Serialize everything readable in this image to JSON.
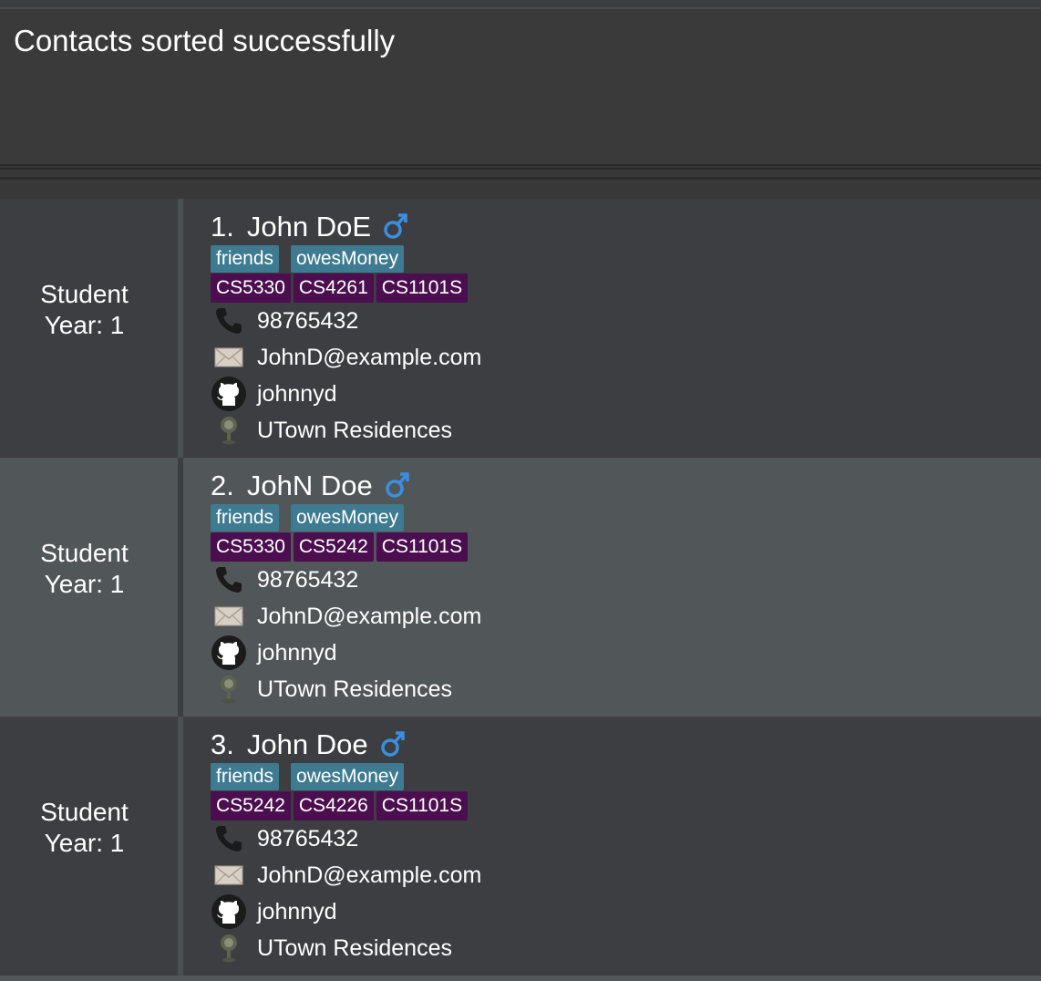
{
  "result": {
    "message": "Contacts sorted successfully"
  },
  "contacts": [
    {
      "index": "1.",
      "name": "John DoE",
      "role": "Student",
      "year": "Year: 1",
      "tags": [
        "friends",
        "owesMoney"
      ],
      "modules": [
        "CS5330",
        "CS4261",
        "CS1101S"
      ],
      "phone": "98765432",
      "email": "JohnD@example.com",
      "github": "johnnyd",
      "address": "UTown Residences"
    },
    {
      "index": "2.",
      "name": "JohN Doe",
      "role": "Student",
      "year": "Year: 1",
      "tags": [
        "friends",
        "owesMoney"
      ],
      "modules": [
        "CS5330",
        "CS5242",
        "CS1101S"
      ],
      "phone": "98765432",
      "email": "JohnD@example.com",
      "github": "johnnyd",
      "address": "UTown Residences"
    },
    {
      "index": "3.",
      "name": "John Doe",
      "role": "Student",
      "year": "Year: 1",
      "tags": [
        "friends",
        "owesMoney"
      ],
      "modules": [
        "CS5242",
        "CS4226",
        "CS1101S"
      ],
      "phone": "98765432",
      "email": "JohnD@example.com",
      "github": "johnnyd",
      "address": "UTown Residences"
    }
  ],
  "icons": {
    "gender": "male-symbol-icon",
    "phone": "phone-icon",
    "email": "envelope-icon",
    "github": "github-icon",
    "address": "map-pin-icon"
  },
  "colors": {
    "tag": "#3e7b91",
    "module": "#4b0f4f",
    "gender": "#3a8fe0"
  }
}
